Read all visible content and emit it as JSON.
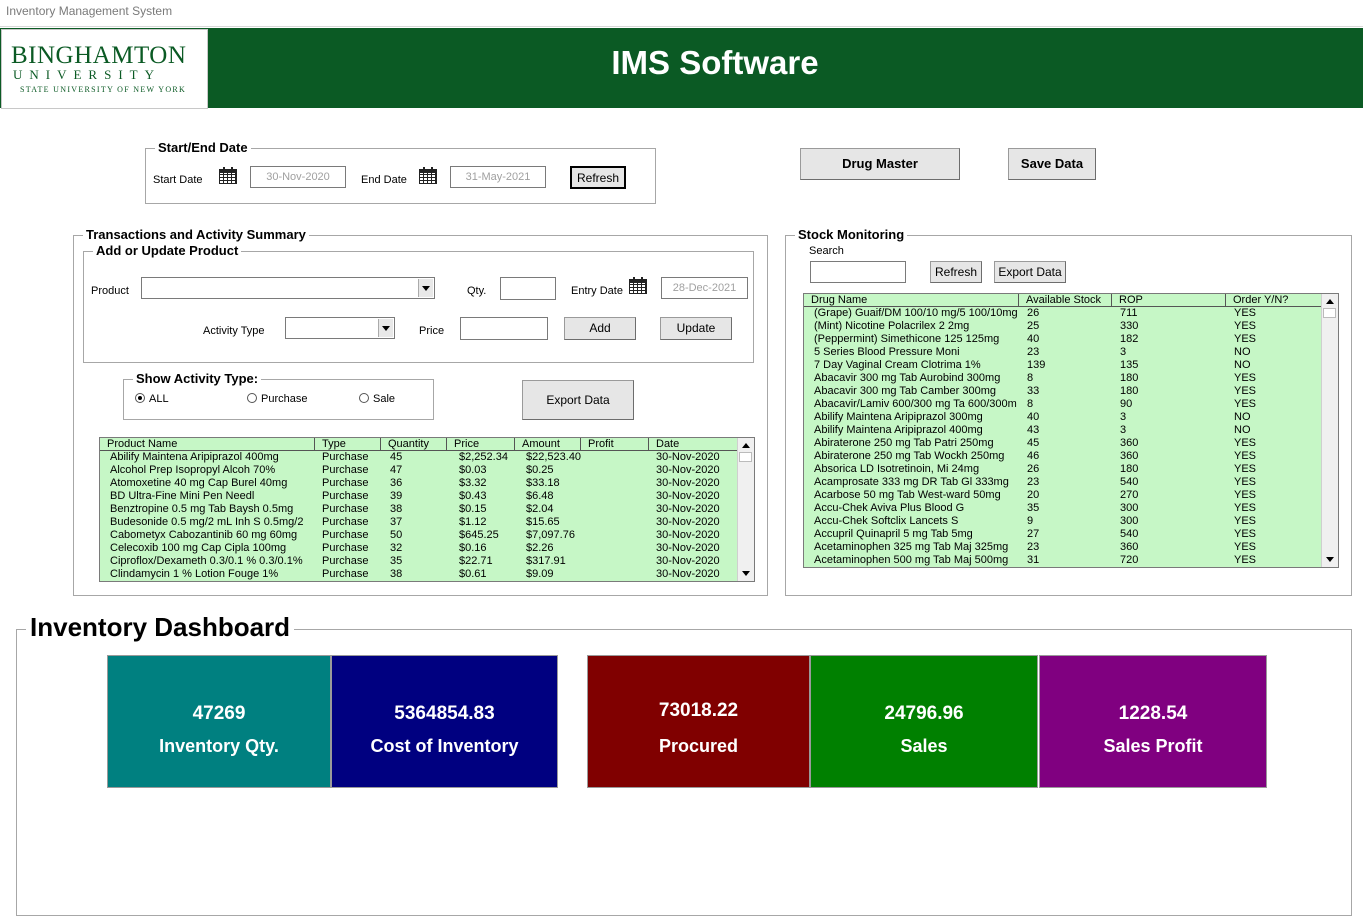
{
  "window": {
    "title": "Inventory Management System"
  },
  "header": {
    "logo": {
      "line1": "BINGHAMTON",
      "line2": "UNIVERSITY",
      "line3": "STATE UNIVERSITY OF NEW YORK"
    },
    "app_title": "IMS Software",
    "brand_color": "#0b5a24"
  },
  "date_range": {
    "legend": "Start/End Date",
    "start_label": "Start Date",
    "start_value": "30-Nov-2020",
    "end_label": "End Date",
    "end_value": "31-May-2021",
    "refresh": "Refresh"
  },
  "top_buttons": {
    "drug_master": "Drug Master",
    "save_data": "Save Data"
  },
  "transactions": {
    "legend": "Transactions and Activity Summary",
    "form": {
      "legend": "Add or Update Product",
      "product_label": "Product",
      "product_value": "",
      "qty_label": "Qty.",
      "qty_value": "",
      "entry_date_label": "Entry Date",
      "entry_date_value": "28-Dec-2021",
      "activity_label": "Activity Type",
      "activity_value": "",
      "price_label": "Price",
      "price_value": "",
      "add": "Add",
      "update": "Update"
    },
    "filter": {
      "legend": "Show Activity Type:",
      "options": [
        "ALL",
        "Purchase",
        "Sale"
      ],
      "selected": "ALL"
    },
    "export": "Export Data",
    "table": {
      "columns": [
        "Product Name",
        "Type",
        "Quantity",
        "Price",
        "Amount",
        "Profit",
        "Date"
      ],
      "rows": [
        [
          "Abilify Maintena Aripiprazol 400mg",
          "Purchase",
          "45",
          "$2,252.34",
          "$22,523.40",
          "",
          "30-Nov-2020"
        ],
        [
          "Alcohol Prep Isopropyl Alcoh 70%",
          "Purchase",
          "47",
          "$0.03",
          "$0.25",
          "",
          "30-Nov-2020"
        ],
        [
          "Atomoxetine 40 mg Cap Burel 40mg",
          "Purchase",
          "36",
          "$3.32",
          "$33.18",
          "",
          "30-Nov-2020"
        ],
        [
          "BD Ultra-Fine Mini Pen Needl",
          "Purchase",
          "39",
          "$0.43",
          "$6.48",
          "",
          "30-Nov-2020"
        ],
        [
          "Benztropine 0.5 mg Tab Baysh 0.5mg",
          "Purchase",
          "38",
          "$0.15",
          "$2.04",
          "",
          "30-Nov-2020"
        ],
        [
          "Budesonide 0.5 mg/2 mL Inh S 0.5mg/2",
          "Purchase",
          "37",
          "$1.12",
          "$15.65",
          "",
          "30-Nov-2020"
        ],
        [
          "Cabometyx Cabozantinib 60 mg 60mg",
          "Purchase",
          "50",
          "$645.25",
          "$7,097.76",
          "",
          "30-Nov-2020"
        ],
        [
          "Celecoxib 100 mg Cap Cipla 100mg",
          "Purchase",
          "32",
          "$0.16",
          "$2.26",
          "",
          "30-Nov-2020"
        ],
        [
          "Ciproflox/Dexameth 0.3/0.1 % 0.3/0.1%",
          "Purchase",
          "35",
          "$22.71",
          "$317.91",
          "",
          "30-Nov-2020"
        ],
        [
          "Clindamycin 1 % Lotion Fouge 1%",
          "Purchase",
          "38",
          "$0.61",
          "$9.09",
          "",
          "30-Nov-2020"
        ]
      ]
    }
  },
  "stock": {
    "legend": "Stock Monitoring",
    "search_label": "Search",
    "search_value": "",
    "refresh": "Refresh",
    "export": "Export Data",
    "table": {
      "columns": [
        "Drug Name",
        "Available Stock",
        "ROP",
        "Order Y/N?"
      ],
      "rows": [
        [
          "(Grape) Guaif/DM 100/10 mg/5 100/10mg",
          "26",
          "711",
          "YES"
        ],
        [
          "(Mint) Nicotine Polacrilex 2 2mg",
          "25",
          "330",
          "YES"
        ],
        [
          "(Peppermint) Simethicone 125 125mg",
          "40",
          "182",
          "YES"
        ],
        [
          "5 Series Blood Pressure Moni",
          "23",
          "3",
          "NO"
        ],
        [
          "7 Day Vaginal Cream Clotrima 1%",
          "139",
          "135",
          "NO"
        ],
        [
          "Abacavir 300 mg Tab Aurobind 300mg",
          "8",
          "180",
          "YES"
        ],
        [
          "Abacavir 300 mg Tab Camber 300mg",
          "33",
          "180",
          "YES"
        ],
        [
          "Abacavir/Lamiv 600/300 mg Ta 600/300m",
          "8",
          "90",
          "YES"
        ],
        [
          "Abilify Maintena Aripiprazol 300mg",
          "40",
          "3",
          "NO"
        ],
        [
          "Abilify Maintena Aripiprazol 400mg",
          "43",
          "3",
          "NO"
        ],
        [
          "Abiraterone 250 mg Tab Patri 250mg",
          "45",
          "360",
          "YES"
        ],
        [
          "Abiraterone 250 mg Tab Wockh 250mg",
          "46",
          "360",
          "YES"
        ],
        [
          "Absorica LD Isotretinoin, Mi 24mg",
          "26",
          "180",
          "YES"
        ],
        [
          "Acamprosate 333 mg DR Tab Gl 333mg",
          "23",
          "540",
          "YES"
        ],
        [
          "Acarbose 50 mg Tab West-ward 50mg",
          "20",
          "270",
          "YES"
        ],
        [
          "Accu-Chek Aviva Plus Blood G",
          "35",
          "300",
          "YES"
        ],
        [
          "Accu-Chek Softclix Lancets S",
          "9",
          "300",
          "YES"
        ],
        [
          "Accupril Quinapril 5 mg Tab 5mg",
          "27",
          "540",
          "YES"
        ],
        [
          "Acetaminophen 325 mg Tab Maj 325mg",
          "23",
          "360",
          "YES"
        ],
        [
          "Acetaminophen 500 mg Tab Maj 500mg",
          "31",
          "720",
          "YES"
        ]
      ]
    }
  },
  "dashboard": {
    "title": "Inventory Dashboard",
    "kpis": [
      {
        "value": "47269",
        "label": "Inventory Qty.",
        "color": "#008080"
      },
      {
        "value": "5364854.83",
        "label": "Cost of Inventory",
        "color": "#000080"
      },
      {
        "value": "73018.22",
        "label": "Procured",
        "color": "#800000"
      },
      {
        "value": "24796.96",
        "label": "Sales",
        "color": "#008000"
      },
      {
        "value": "1228.54",
        "label": "Sales Profit",
        "color": "#800080"
      }
    ]
  }
}
